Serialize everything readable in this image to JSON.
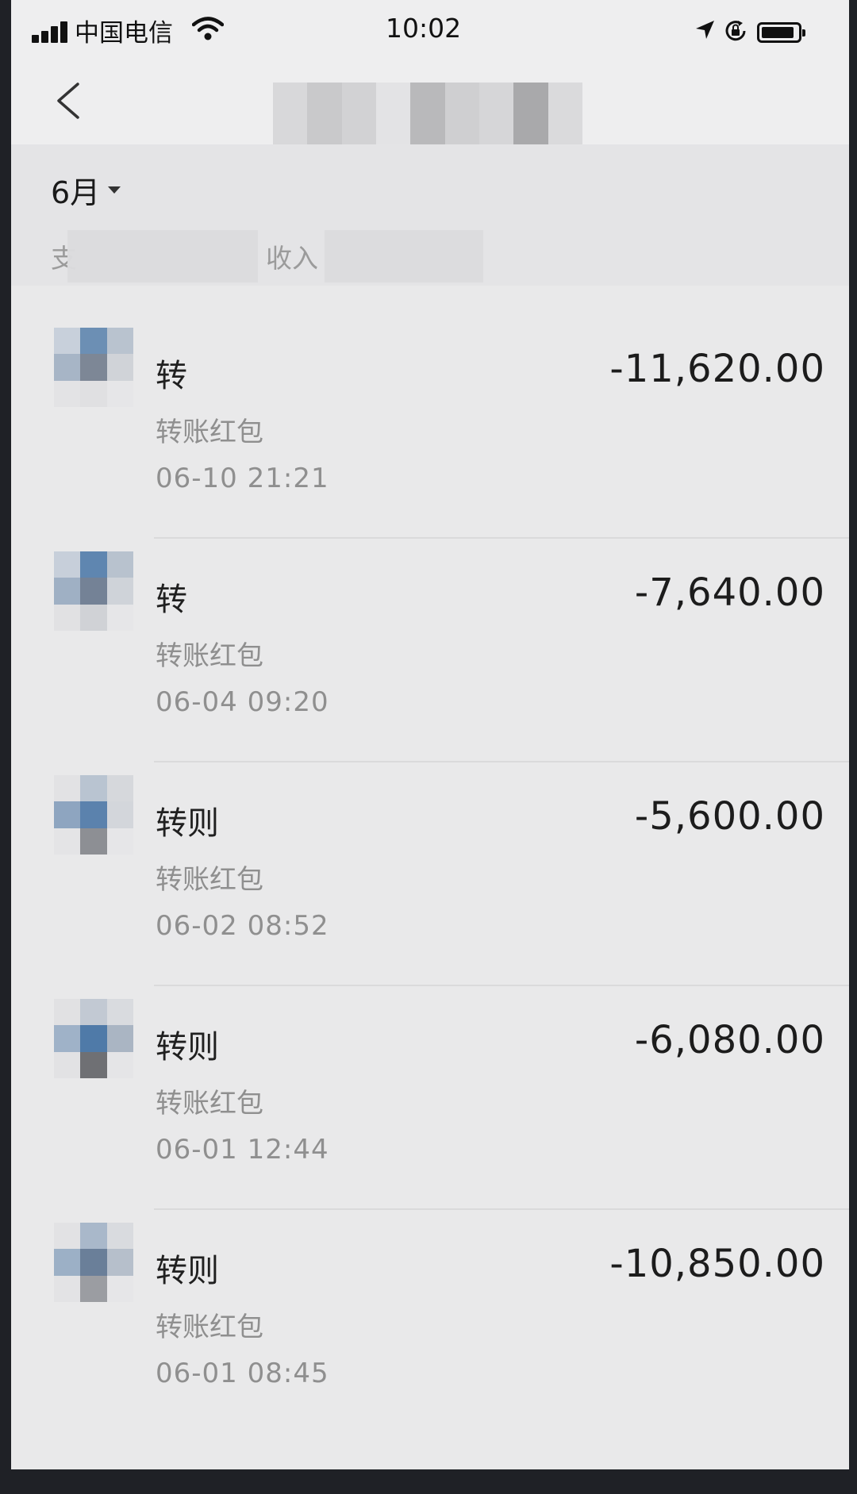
{
  "status_bar": {
    "carrier": "中国电信",
    "time": "10:02"
  },
  "header": {
    "month": "6月",
    "expense_label": "支",
    "income_label": "收入"
  },
  "transactions": [
    {
      "name_prefix": "转",
      "type": "转账红包",
      "time": "06-10  21:21",
      "amount": "-11,620.00"
    },
    {
      "name_prefix": "转",
      "type": "转账红包",
      "time": "06-04  09:20",
      "amount": "-7,640.00"
    },
    {
      "name_prefix": "转则",
      "type": "转账红包",
      "time": "06-02  08:52",
      "amount": "-5,600.00"
    },
    {
      "name_prefix": "转则",
      "type": "转账红包",
      "time": "06-01  12:44",
      "amount": "-6,080.00"
    },
    {
      "name_prefix": "转则",
      "type": "转账红包",
      "time": "06-01  08:45",
      "amount": "-10,850.00"
    }
  ],
  "colors": {
    "background": "#e9e9ea",
    "text_primary": "#1c1c1c",
    "text_secondary": "#8f8f8f"
  }
}
